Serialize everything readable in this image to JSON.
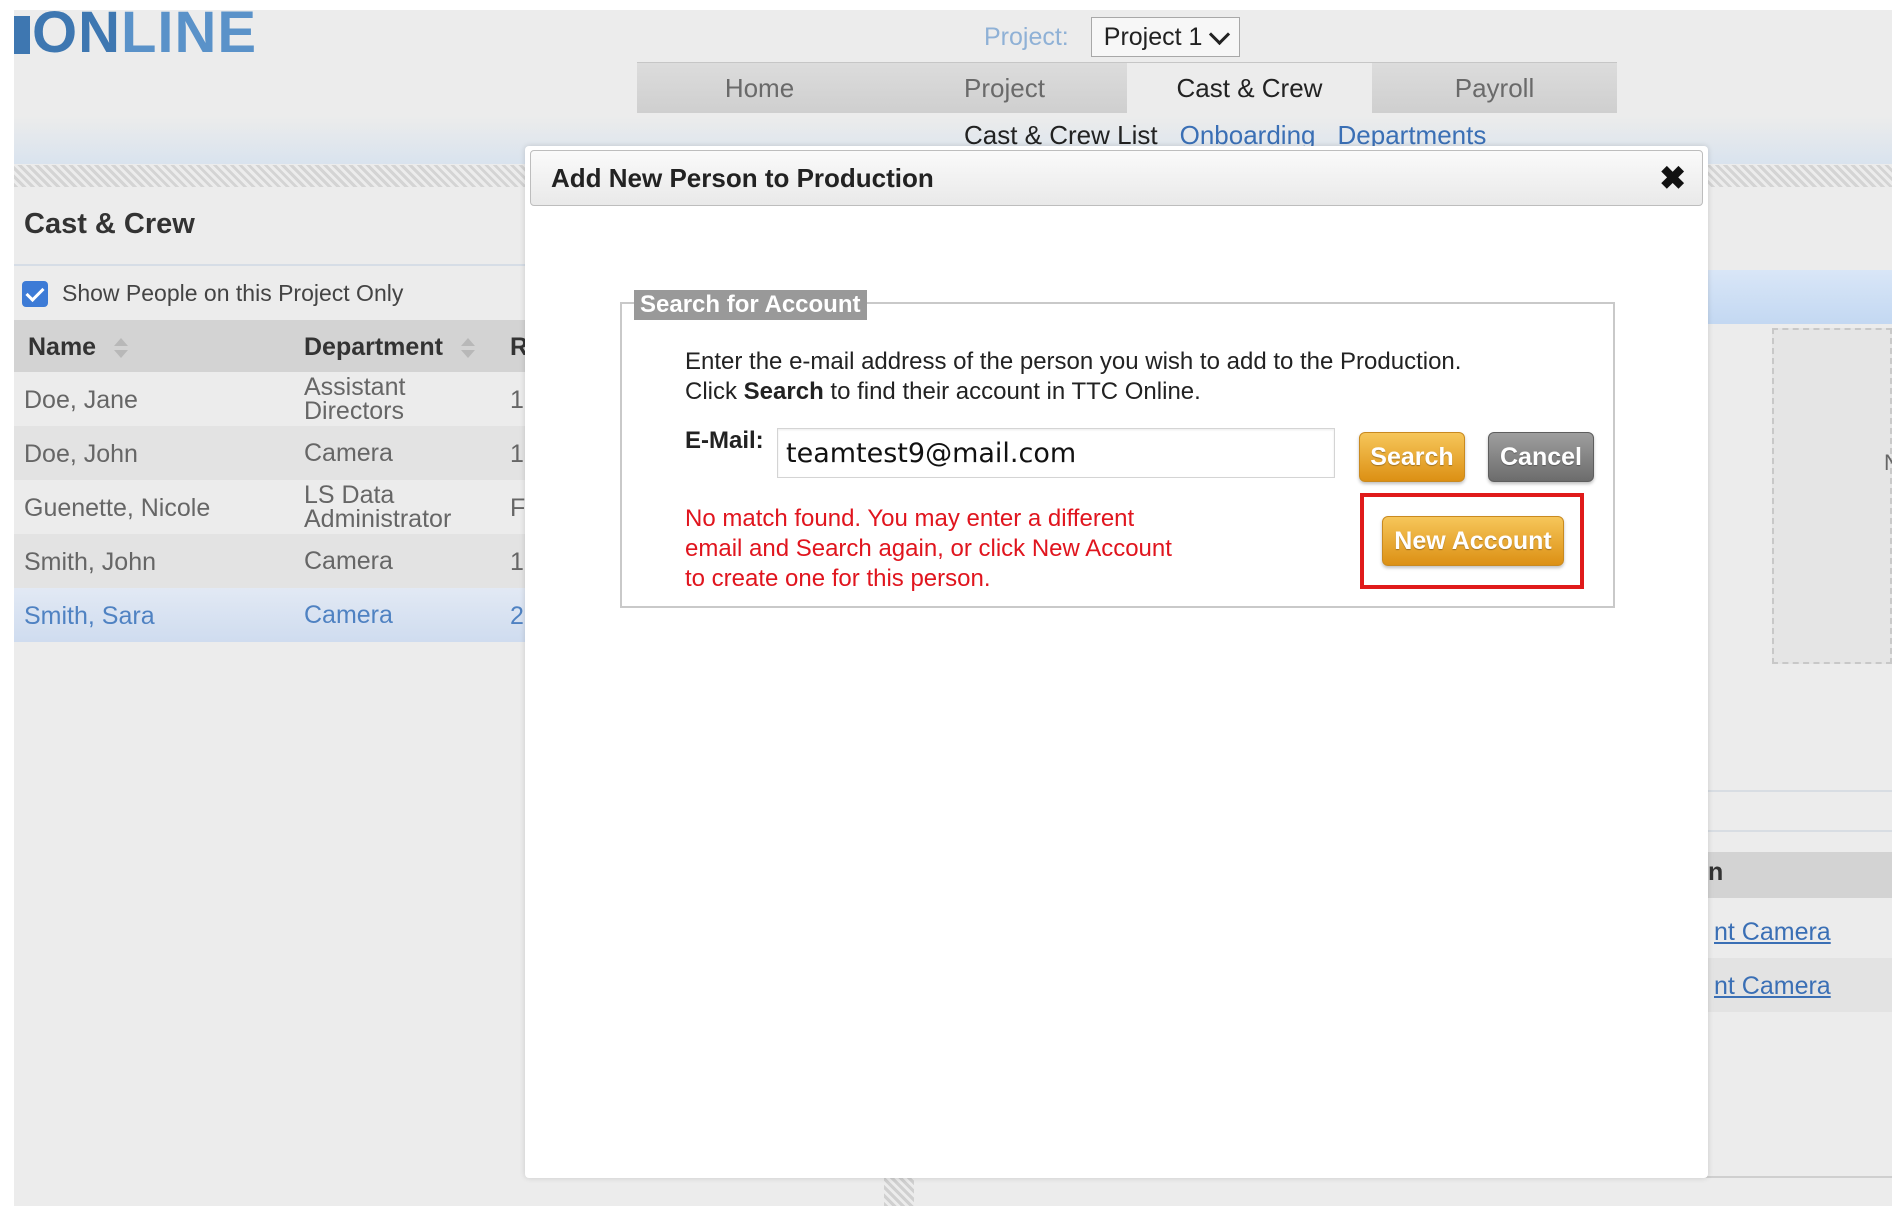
{
  "app": {
    "logo_text_dark": "ON",
    "logo_text_light": "LINE"
  },
  "project_selector": {
    "label": "Project:",
    "value": "Project 1"
  },
  "nav": {
    "tabs": [
      {
        "label": "Home",
        "active": false
      },
      {
        "label": "Project",
        "active": false
      },
      {
        "label": "Cast & Crew",
        "active": true
      },
      {
        "label": "Payroll",
        "active": false
      }
    ],
    "subnav": {
      "current": "Cast & Crew List",
      "links": [
        "Onboarding",
        "Departments"
      ]
    }
  },
  "left_panel": {
    "title": "Cast & Crew",
    "filter_checkbox": {
      "label": "Show People on this Project Only",
      "checked": true
    },
    "columns": [
      "Name",
      "Department",
      "R"
    ],
    "rows": [
      {
        "name": "Doe, Jane",
        "department": "Assistant Directors",
        "r": "1",
        "selected": false
      },
      {
        "name": "Doe, John",
        "department": "Camera",
        "r": "1",
        "selected": false
      },
      {
        "name": "Guenette, Nicole",
        "department": "LS Data Administrator",
        "r": "F",
        "selected": false
      },
      {
        "name": "Smith, John",
        "department": "Camera",
        "r": "1",
        "selected": false
      },
      {
        "name": "Smith, Sara",
        "department": "Camera",
        "r": "2",
        "selected": true
      }
    ]
  },
  "right_panel": {
    "partial_letter": "N",
    "header_partial": "n",
    "links": [
      "nt Camera",
      "nt Camera"
    ]
  },
  "modal": {
    "title": "Add New Person to Production",
    "close_glyph": "✖",
    "section_legend": "Search for Account",
    "instruction_line1": "Enter the e-mail address of the person you wish to add to the Production.",
    "instruction_line2_pre": "Click ",
    "instruction_line2_bold": "Search",
    "instruction_line2_post": " to find their account in TTC Online.",
    "email_label": "E-Mail:",
    "email_value": "teamtest9@mail.com",
    "search_button": "Search",
    "cancel_button": "Cancel",
    "error_lines": [
      "No match found. You may enter a different",
      "email and Search again, or click New Account",
      "to create one for this person."
    ],
    "new_account_button": "New Account"
  },
  "colors": {
    "accent_blue": "#3a6fb5",
    "error_red": "#e0151e",
    "highlight_red": "#e01a1a",
    "button_orange": "#e9a32e"
  }
}
